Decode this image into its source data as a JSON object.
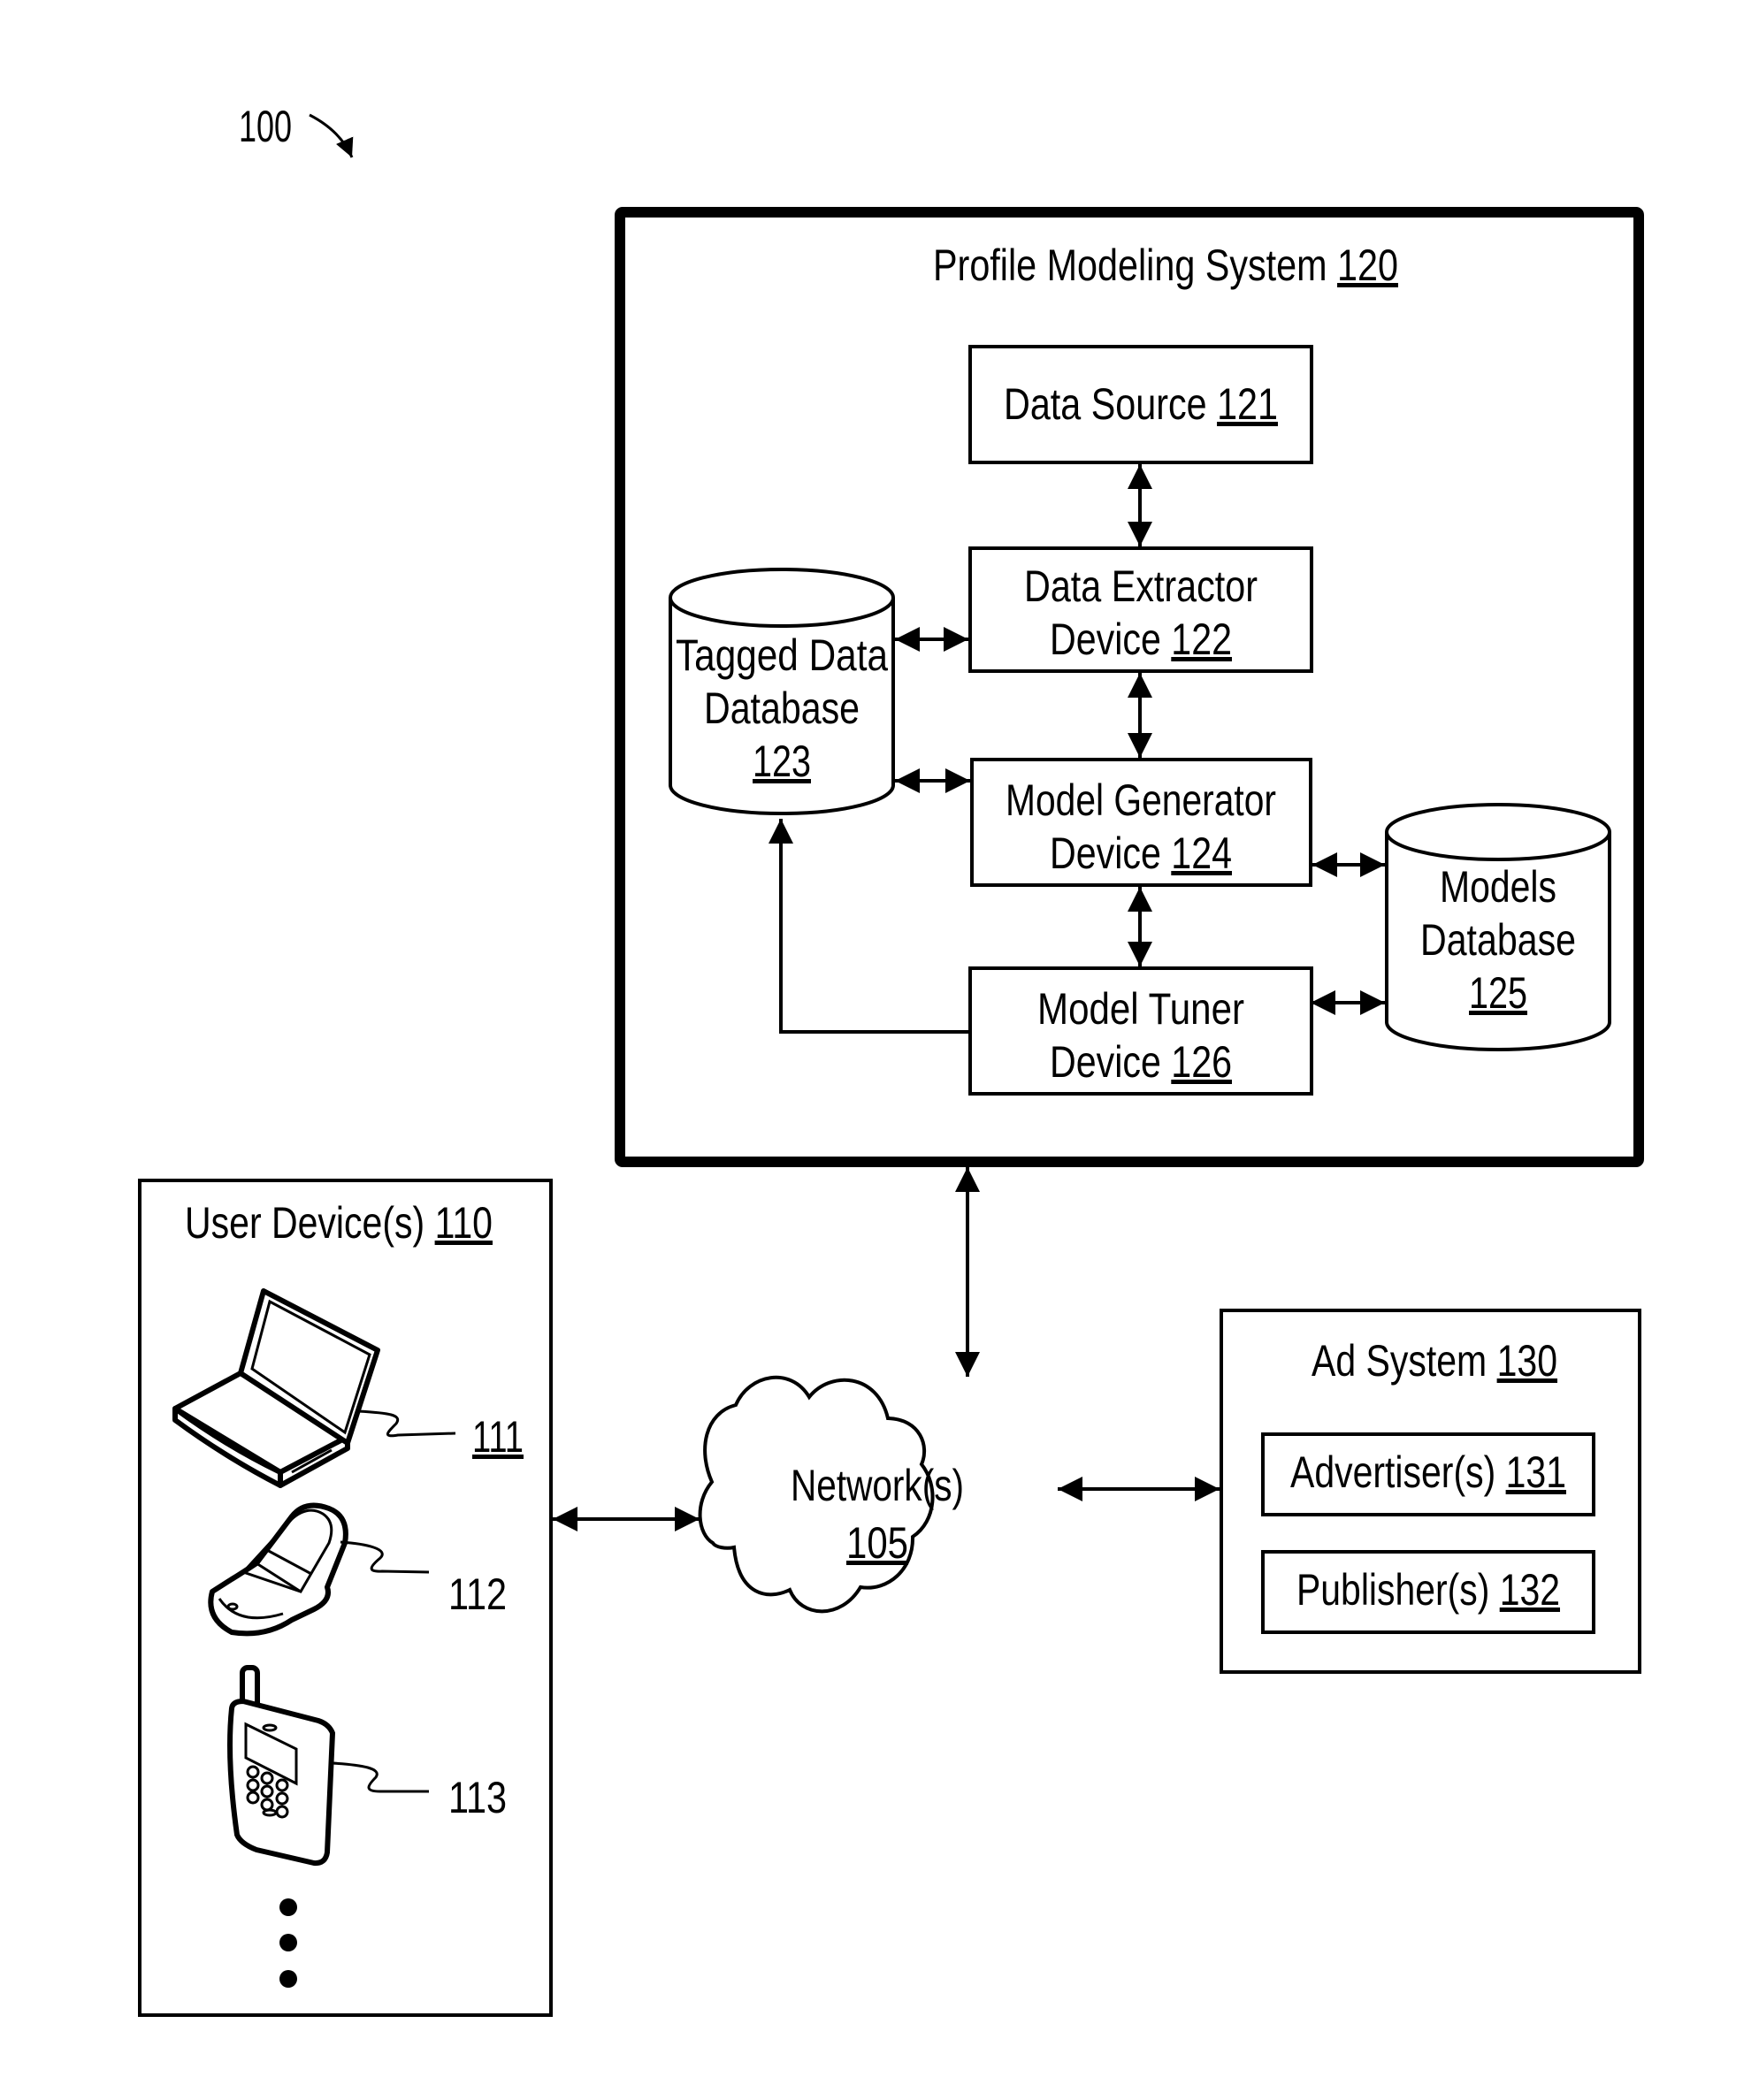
{
  "figure": {
    "ref_number": "100"
  },
  "profile_modeling_system": {
    "title": "Profile Modeling System",
    "ref": "120",
    "data_source": {
      "line1": "Data Source",
      "ref": "121"
    },
    "data_extractor": {
      "line1": "Data Extractor",
      "line2": "Device",
      "ref": "122"
    },
    "tagged_data_db": {
      "line1": "Tagged Data",
      "line2": "Database",
      "ref": "123"
    },
    "model_generator": {
      "line1": "Model Generator",
      "line2": "Device",
      "ref": "124"
    },
    "models_db": {
      "line1": "Models",
      "line2": "Database",
      "ref": "125"
    },
    "model_tuner": {
      "line1": "Model Tuner",
      "line2": "Device",
      "ref": "126"
    }
  },
  "user_devices": {
    "title": "User Device(s)",
    "ref": "110",
    "devices": [
      {
        "icon": "laptop-icon",
        "ref": "111"
      },
      {
        "icon": "flip-phone-icon",
        "ref": "112"
      },
      {
        "icon": "mobile-phone-icon",
        "ref": "113"
      }
    ],
    "more_indicator": "ellipsis-vertical"
  },
  "network": {
    "title": "Network(s)",
    "ref": "105",
    "icon": "cloud-icon"
  },
  "ad_system": {
    "title": "Ad System",
    "ref": "130",
    "advertisers": {
      "label": "Advertiser(s)",
      "ref": "131"
    },
    "publishers": {
      "label": "Publisher(s)",
      "ref": "132"
    }
  }
}
